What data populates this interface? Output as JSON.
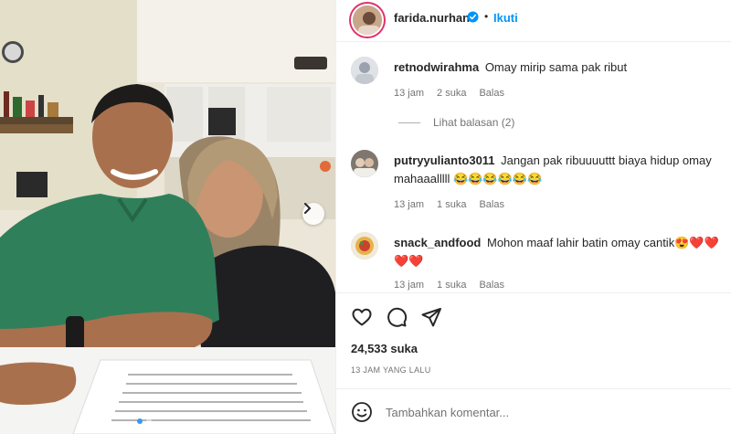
{
  "post": {
    "username": "farida.nurhan",
    "separator": "•",
    "follow_label": "Ikuti",
    "likes": "24,533 suka",
    "time_ago": "13 JAM YANG LALU"
  },
  "comments": [
    {
      "username": "retnodwirahma",
      "text": "Omay mirip sama pak ribut",
      "time": "13 jam",
      "likes": "2 suka",
      "reply_label": "Balas"
    },
    {
      "username": "putryyulianto3011",
      "text": "Jangan pak ribuuuuttt biaya hidup omay mahaaalllll 😂😂😂😂😂😂",
      "time": "13 jam",
      "likes": "1 suka",
      "reply_label": "Balas"
    },
    {
      "username": "snack_andfood",
      "text": "Mohon maaf lahir batin omay cantik😍❤️❤️❤️❤️",
      "time": "13 jam",
      "likes": "1 suka",
      "reply_label": "Balas"
    }
  ],
  "view_replies": "Lihat balasan (2)",
  "add_comment": {
    "placeholder": "Tambahkan komentar..."
  },
  "colors": {
    "link_blue": "#0095f6",
    "verified_blue": "#0095f6",
    "text": "#262626",
    "muted": "#737373"
  },
  "icons": [
    "verified-badge-icon",
    "chevron-right-icon",
    "heart-icon",
    "comment-icon",
    "share-icon",
    "emoji-icon"
  ]
}
